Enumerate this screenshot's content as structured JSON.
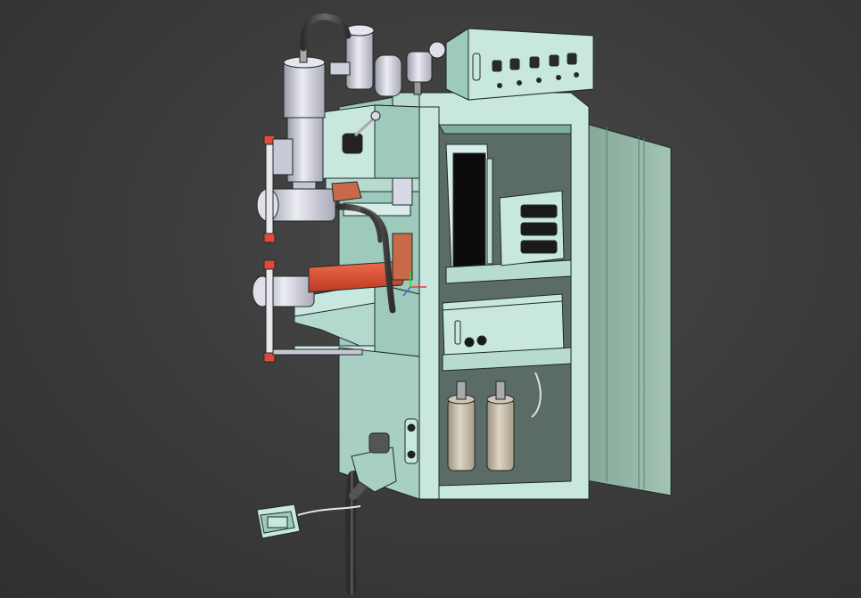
{
  "viewport": {
    "background": "#3c3c3c",
    "model": "spot-welding-machine-assembly"
  },
  "colors": {
    "cabinet_face": "#c8e8df",
    "cabinet_side": "#9ec9bd",
    "cabinet_shadow": "#7fae9f",
    "door": "#8fb3a3",
    "door_dark": "#6f9585",
    "cylinder": "#d8d8e6",
    "cylinder_shade": "#a8a8b8",
    "electrode_holder": "#d94a2e",
    "copper": "#c8694a",
    "transformer_can": "#c9bfae",
    "hose": "#4a4a4a",
    "outline": "#202020",
    "pedal": "#c8e8df",
    "triad_x": "#e23b3b",
    "triad_y": "#3bd43b",
    "triad_z": "#3b6be2"
  },
  "parts": [
    {
      "name": "cabinet-body"
    },
    {
      "name": "control-box-top"
    },
    {
      "name": "cabinet-door"
    },
    {
      "name": "pneumatic-cylinder"
    },
    {
      "name": "air-filter-regulator"
    },
    {
      "name": "upper-arm"
    },
    {
      "name": "lower-arm"
    },
    {
      "name": "upper-electrode"
    },
    {
      "name": "lower-electrode"
    },
    {
      "name": "lower-electrode-holder"
    },
    {
      "name": "controller-panel-upper"
    },
    {
      "name": "controller-panel-lower"
    },
    {
      "name": "transformer-capacitors"
    },
    {
      "name": "foot-pedal"
    },
    {
      "name": "cooling-hoses"
    }
  ]
}
